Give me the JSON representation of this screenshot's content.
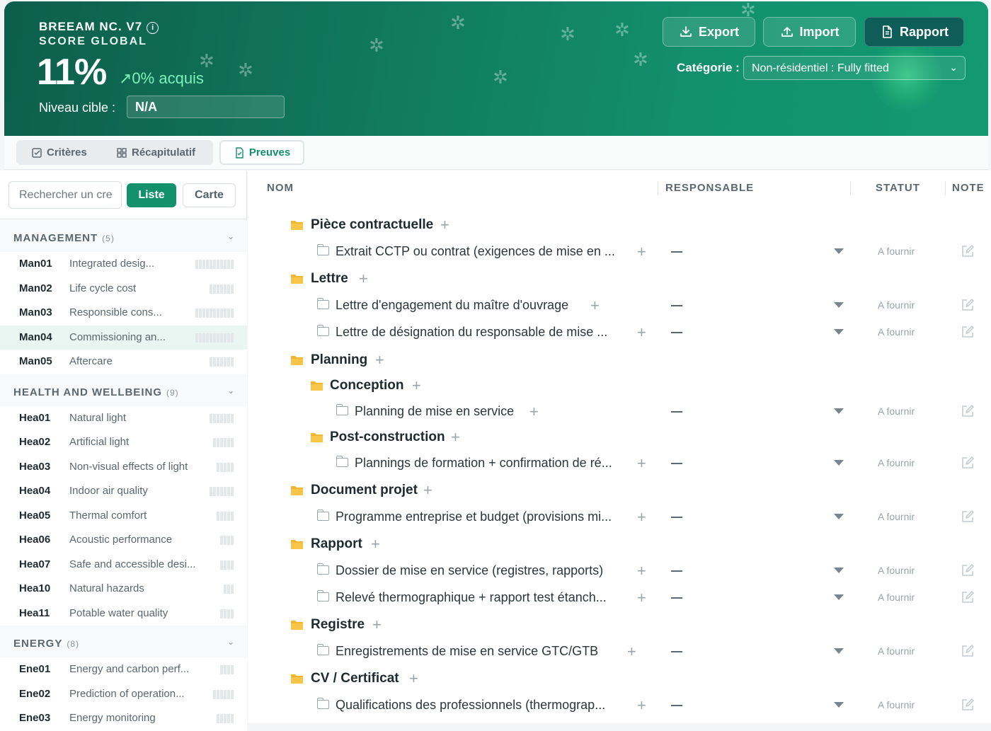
{
  "header": {
    "title": "BREEAM NC. V7",
    "info_icon": "i",
    "subtitle": "SCORE GLOBAL",
    "score": "11%",
    "trend": "↗0% acquis",
    "level_label": "Niveau cible :",
    "level_value": "N/A",
    "buttons": {
      "export": "Export",
      "import": "Import",
      "rapport": "Rapport"
    },
    "category_label": "Catégorie :",
    "category_value": "Non-résidentiel : Fully fitted"
  },
  "tabs": {
    "criteres": "Critères",
    "recap": "Récapitulatif",
    "preuves": "Preuves"
  },
  "sidebar": {
    "search_placeholder": "Rechercher un cre",
    "view_list": "Liste",
    "view_map": "Carte",
    "groups": [
      {
        "name": "MANAGEMENT",
        "count": "(5)",
        "items": [
          {
            "code": "Man01",
            "name": "Integrated desig..."
          },
          {
            "code": "Man02",
            "name": "Life cycle cost"
          },
          {
            "code": "Man03",
            "name": "Responsible cons..."
          },
          {
            "code": "Man04",
            "name": "Commissioning an..."
          },
          {
            "code": "Man05",
            "name": "Aftercare"
          }
        ]
      },
      {
        "name": "HEALTH AND WELLBEING",
        "count": "(9)",
        "items": [
          {
            "code": "Hea01",
            "name": "Natural light"
          },
          {
            "code": "Hea02",
            "name": "Artificial light"
          },
          {
            "code": "Hea03",
            "name": "Non-visual effects of light"
          },
          {
            "code": "Hea04",
            "name": "Indoor air quality"
          },
          {
            "code": "Hea05",
            "name": "Thermal comfort"
          },
          {
            "code": "Hea06",
            "name": "Acoustic performance"
          },
          {
            "code": "Hea07",
            "name": "Safe and accessible desi..."
          },
          {
            "code": "Hea10",
            "name": "Natural hazards"
          },
          {
            "code": "Hea11",
            "name": "Potable water quality"
          }
        ]
      },
      {
        "name": "ENERGY",
        "count": "(8)",
        "items": [
          {
            "code": "Ene01",
            "name": "Energy and carbon perf..."
          },
          {
            "code": "Ene02",
            "name": "Prediction of operation..."
          },
          {
            "code": "Ene03",
            "name": "Energy monitoring"
          }
        ]
      }
    ]
  },
  "table": {
    "col_nom": "NOM",
    "col_responsable": "RESPONSABLE",
    "col_statut": "STATUT",
    "col_note": "NOTE",
    "rows": [
      {
        "type": "folder",
        "level": 0,
        "name": "Pièce contractuelle"
      },
      {
        "type": "doc",
        "level": 1,
        "name": "Extrait CCTP ou contrat (exigences de mise en ...",
        "responsable": "—",
        "statut": "A fournir"
      },
      {
        "type": "folder",
        "level": 0,
        "name": "Lettre"
      },
      {
        "type": "doc",
        "level": 1,
        "name": "Lettre d'engagement du maître d'ouvrage",
        "responsable": "—",
        "statut": "A fournir"
      },
      {
        "type": "doc",
        "level": 1,
        "name": "Lettre de désignation du responsable de mise ...",
        "responsable": "—",
        "statut": "A fournir"
      },
      {
        "type": "folder",
        "level": 0,
        "name": "Planning"
      },
      {
        "type": "folder",
        "level": 1,
        "name": "Conception"
      },
      {
        "type": "doc",
        "level": 2,
        "name": "Planning de mise en service",
        "responsable": "—",
        "statut": "A fournir"
      },
      {
        "type": "folder",
        "level": 1,
        "name": "Post-construction"
      },
      {
        "type": "doc",
        "level": 2,
        "name": "Plannings de formation + confirmation de ré...",
        "responsable": "—",
        "statut": "A fournir"
      },
      {
        "type": "folder",
        "level": 0,
        "name": "Document projet"
      },
      {
        "type": "doc",
        "level": 1,
        "name": "Programme entreprise et budget (provisions mi...",
        "responsable": "—",
        "statut": "A fournir"
      },
      {
        "type": "folder",
        "level": 0,
        "name": "Rapport"
      },
      {
        "type": "doc",
        "level": 1,
        "name": "Dossier de mise en service (registres, rapports)",
        "responsable": "—",
        "statut": "A fournir"
      },
      {
        "type": "doc",
        "level": 1,
        "name": "Relevé thermographique + rapport test étanch...",
        "responsable": "—",
        "statut": "A fournir"
      },
      {
        "type": "folder",
        "level": 0,
        "name": "Registre"
      },
      {
        "type": "doc",
        "level": 1,
        "name": "Enregistrements de mise en service GTC/GTB",
        "responsable": "—",
        "statut": "A fournir"
      },
      {
        "type": "folder",
        "level": 0,
        "name": "CV / Certificat"
      },
      {
        "type": "doc",
        "level": 1,
        "name": "Qualifications des professionnels (thermograp...",
        "responsable": "—",
        "statut": "A fournir"
      }
    ]
  },
  "colors": {
    "accent": "#13906c",
    "header_dark": "#0d5e4b",
    "folder": "#f2b632"
  }
}
